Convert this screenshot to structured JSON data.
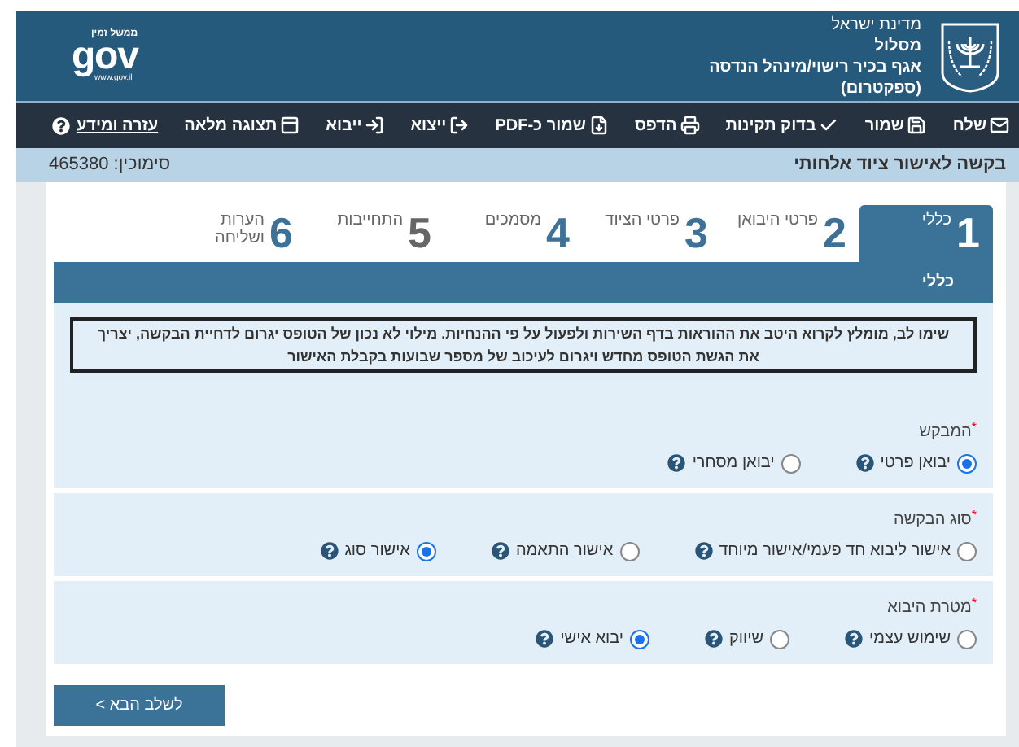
{
  "header": {
    "country": "מדינת ישראל",
    "ministry": "מסלול",
    "department": "אגף בכיר רישוי/מינהל הנדסה",
    "unit": "(ספקטרום)",
    "logo": {
      "top": "ממשל זמין",
      "word": "gov",
      "site": "www.gov.il"
    }
  },
  "toolbar": [
    "שלח",
    "שמור",
    "בדוק תקינות",
    "הדפס",
    "שמור כ-PDF",
    "ייצוא",
    "ייבוא",
    "תצוגה מלאה"
  ],
  "help_link": "עזרה ומידע",
  "form_title": "בקשה לאישור ציוד אלחותי",
  "reference": "סימוכין: 465380",
  "steps": [
    {
      "number": "1",
      "label": "כללי",
      "selected": true,
      "disabled": false
    },
    {
      "number": "2",
      "label": "פרטי היבואן",
      "selected": false,
      "disabled": false
    },
    {
      "number": "3",
      "label": "פרטי הציוד",
      "selected": false,
      "disabled": false
    },
    {
      "number": "4",
      "label": "מסמכים",
      "selected": false,
      "disabled": false
    },
    {
      "number": "5",
      "label": "התחייבות",
      "selected": false,
      "disabled": true
    },
    {
      "number": "6",
      "label": "הערות ושליחה",
      "selected": false,
      "disabled": false
    }
  ],
  "section_title": "כללי",
  "notice": "שימו לב, מומלץ לקרוא היטב את ההוראות בדף השירות ולפעול על פי ההנחיות. מילוי לא נכון של הטופס יגרום לדחיית הבקשה, יצריך את הגשת הטופס מחדש ויגרום לעיכוב של מספר שבועות בקבלת האישור",
  "questions": [
    {
      "label": "המבקש",
      "required_mark": "*",
      "options": [
        {
          "label": "יבואן פרטי",
          "selected": true
        },
        {
          "label": "יבואן מסחרי",
          "selected": false
        }
      ]
    },
    {
      "label": "סוג הבקשה",
      "required_mark": "*",
      "options": [
        {
          "label": "אישור ליבוא חד פעמי/אישור מיוחד",
          "selected": false
        },
        {
          "label": "אישור התאמה",
          "selected": false
        },
        {
          "label": "אישור סוג",
          "selected": true
        }
      ]
    },
    {
      "label": "מטרת היבוא",
      "required_mark": "*",
      "options": [
        {
          "label": "שימוש עצמי",
          "selected": false
        },
        {
          "label": "שיווק",
          "selected": false
        },
        {
          "label": "יבוא אישי",
          "selected": true
        }
      ]
    }
  ],
  "next_button": "לשלב הבא >"
}
